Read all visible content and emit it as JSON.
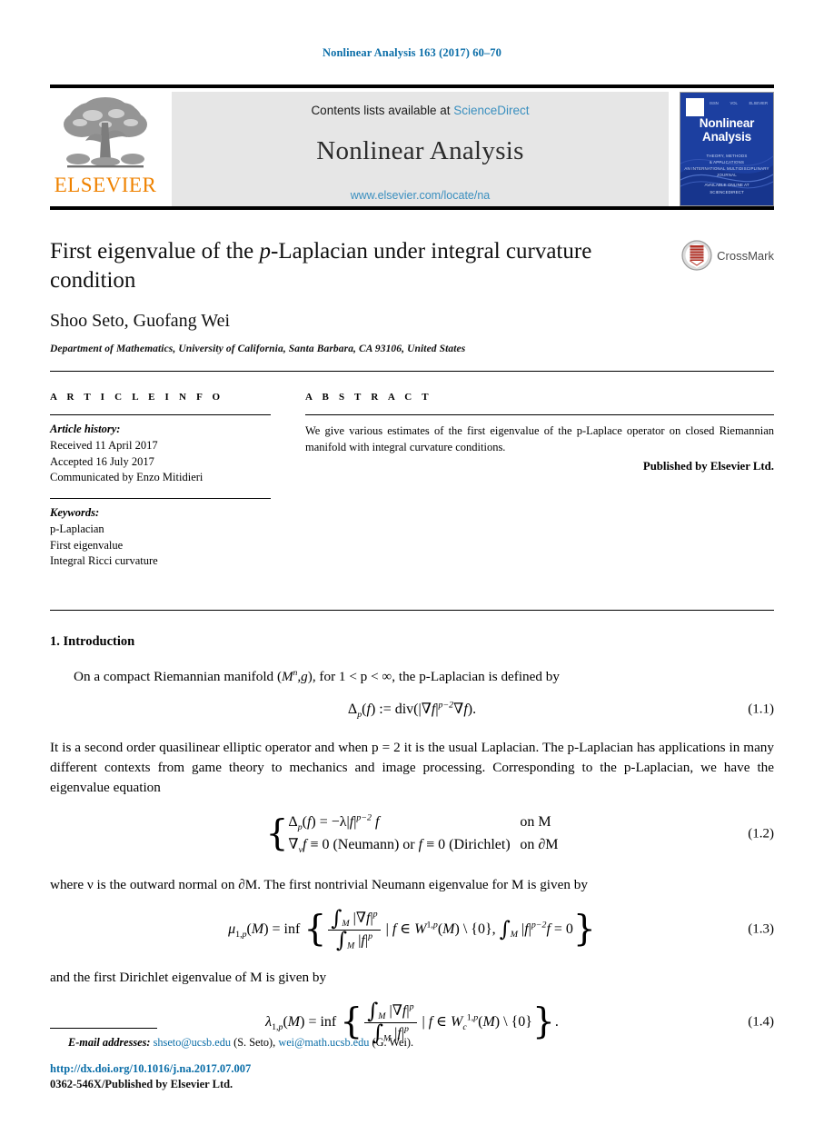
{
  "running_head": "Nonlinear Analysis 163 (2017) 60–70",
  "masthead": {
    "contents_prefix": "Contents lists available at ",
    "sciencedirect": "ScienceDirect",
    "journal_name": "Nonlinear Analysis",
    "journal_url": "www.elsevier.com/locate/na",
    "publisher_wordmark": "ELSEVIER",
    "publisher_logo_name": "elsevier-tree-logo",
    "cover": {
      "title_line1": "Nonlinear",
      "title_line2": "Analysis",
      "sub_line1": "THEORY, METHODS",
      "sub_line2": "& APPLICATIONS",
      "sub_line3": "AN INTERNATIONAL MULTIDISCIPLINARY JOURNAL",
      "bottom_line1": "AVAILABLE ONLINE AT",
      "bottom_line2": "SCIENCEDIRECT",
      "mark_left": "ISSN",
      "mark_mid": "VOL",
      "mark_right": "ELSEVIER"
    }
  },
  "article": {
    "title_part1": "First eigenvalue of the ",
    "title_italic": "p",
    "title_part2": "-Laplacian under integral curvature condition",
    "authors": "Shoo Seto, Guofang Wei",
    "affiliation": "Department of Mathematics, University of California, Santa Barbara, CA 93106, United States",
    "crossmark_label": "CrossMark"
  },
  "info": {
    "heading": "A R T I C L E   I N F O",
    "history_label": "Article history:",
    "received": "Received 11 April 2017",
    "accepted": "Accepted 16 July 2017",
    "communicated": "Communicated by Enzo Mitidieri",
    "keywords_label": "Keywords:",
    "keywords": [
      "p-Laplacian",
      "First eigenvalue",
      "Integral Ricci curvature"
    ]
  },
  "abstract": {
    "heading": "A B S T R A C T",
    "text": "We give various estimates of the first eigenvalue of the p-Laplace operator on closed Riemannian manifold with integral curvature conditions.",
    "published_by": "Published by Elsevier Ltd."
  },
  "body": {
    "section_title": "1. Introduction",
    "p1_a": "On a compact Riemannian manifold (",
    "p1_b": "), for 1 < p < ∞, the p-Laplacian is defined by",
    "eq1_num": "(1.1)",
    "p2": "It is a second order quasilinear elliptic operator and when p = 2 it is the usual Laplacian. The p-Laplacian has applications in many different contexts from game theory to mechanics and image processing. Corresponding to the p-Laplacian, we have the eigenvalue equation",
    "eq2_num": "(1.2)",
    "eq2_case1_left": "Δ",
    "eq2_case1_right": "on M",
    "eq2_case2_right": "on ∂M",
    "p3": "where ν is the outward normal on ∂M. The first nontrivial Neumann eigenvalue for M is given by",
    "eq3_num": "(1.3)",
    "p4": "and the first Dirichlet eigenvalue of M is given by",
    "eq4_num": "(1.4)"
  },
  "footer": {
    "email_label": "E-mail addresses:",
    "email1": "shseto@ucsb.edu",
    "email1_owner": "(S. Seto),",
    "email2": "wei@math.ucsb.edu",
    "email2_owner": "(G. Wei).",
    "doi": "http://dx.doi.org/10.1016/j.na.2017.07.007",
    "issn_line": "0362-546X/Published by Elsevier Ltd."
  },
  "colors": {
    "link_blue": "#0b6ea8",
    "sciencedirect_blue": "#3a8fbf",
    "elsevier_orange": "#ef8200",
    "cover_blue": "#1c3fa0"
  }
}
